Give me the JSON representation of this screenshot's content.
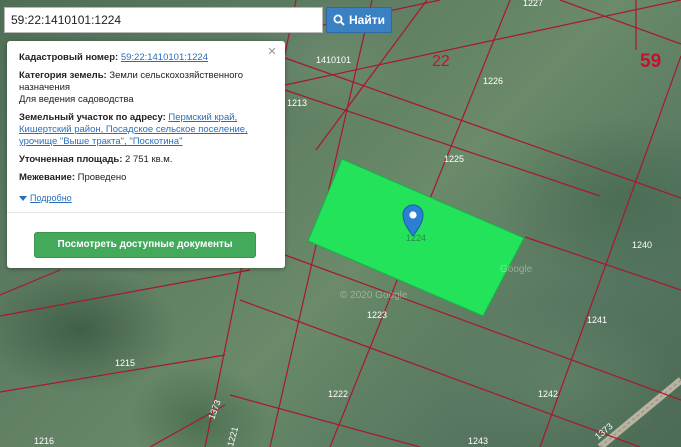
{
  "search": {
    "value": "59:22:1410101:1224",
    "button_label": "Найти"
  },
  "popup": {
    "cadastral_label": "Кадастровый номер:",
    "cadastral_value": "59:22:1410101:1224",
    "category_label": "Категория земель:",
    "category_value": "Земли сельскохозяйственного назначения",
    "category_use": "Для ведения садоводства",
    "address_label": "Земельный участок по адресу:",
    "address_value": "Пермский край, Кишертский район, Посадское сельское поселение, урочище \"Выше тракта\", \"Поскотина\"",
    "area_label": "Уточненная площадь:",
    "area_value": "2 751 кв.м.",
    "survey_label": "Межевание:",
    "survey_value": "Проведено",
    "more_label": "Подробно",
    "docs_button": "Посмотреть доступные документы",
    "close_symbol": "×"
  },
  "map": {
    "district_number": "22",
    "region_number": "59",
    "quarter_label": "1410101",
    "selected_parcel_label": "1224",
    "parcels": [
      "1227",
      "1226",
      "1213",
      "1225",
      "1240",
      "1223",
      "1241",
      "1215",
      "1222",
      "1242",
      "1373",
      "1216",
      "1221",
      "1243",
      "1373"
    ],
    "watermarks": [
      "Google",
      "© 2020 Google"
    ],
    "colors": {
      "parcel_border": "#a8182c",
      "selected_parcel": "#22e35a",
      "marker": "#2b7fd4",
      "region_label": "#c8102e",
      "button_primary": "#3a81c3",
      "button_docs": "#43a95b"
    }
  }
}
